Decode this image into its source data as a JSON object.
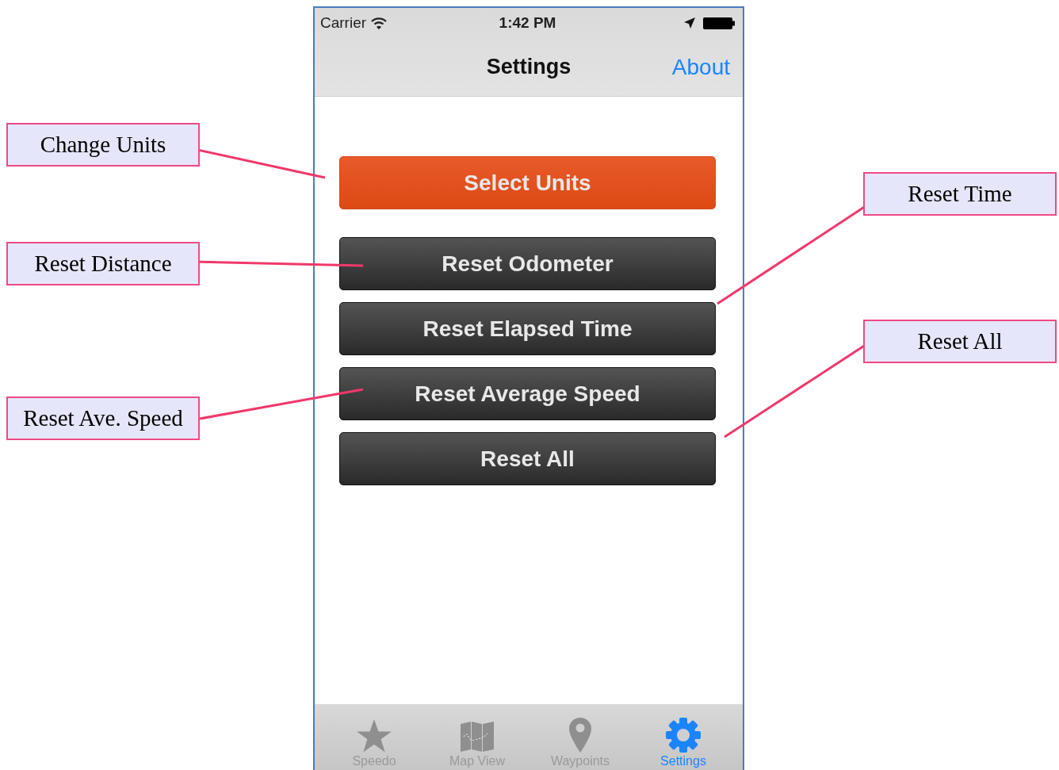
{
  "status_bar": {
    "carrier": "Carrier",
    "time": "1:42 PM"
  },
  "nav": {
    "title": "Settings",
    "action": "About"
  },
  "buttons": [
    {
      "label": "Select Units",
      "kind": "primary"
    },
    {
      "label": "Reset Odometer",
      "kind": "dark"
    },
    {
      "label": "Reset Elapsed Time",
      "kind": "dark"
    },
    {
      "label": "Reset Average Speed",
      "kind": "dark"
    },
    {
      "label": "Reset All",
      "kind": "dark"
    }
  ],
  "tabs": [
    {
      "label": "Speedo",
      "selected": false
    },
    {
      "label": "Map View",
      "selected": false
    },
    {
      "label": "Waypoints",
      "selected": false
    },
    {
      "label": "Settings",
      "selected": true
    }
  ],
  "callouts": [
    {
      "text": "Change Units"
    },
    {
      "text": "Reset Distance"
    },
    {
      "text": "Reset Ave. Speed"
    },
    {
      "text": "Reset Time"
    },
    {
      "text": "Reset All"
    }
  ]
}
